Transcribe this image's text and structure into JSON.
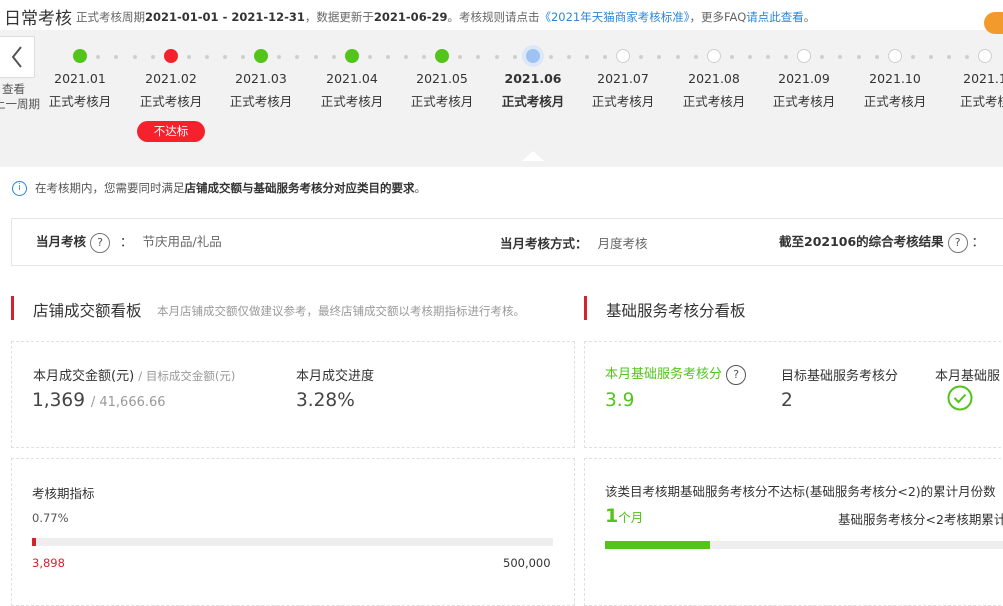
{
  "header": {
    "title": "日常考核",
    "period_prefix": "正式考核周期",
    "period_range": "2021-01-01 - 2021-12-31",
    "update_prefix": "，数据更新于",
    "update_date": "2021-06-29",
    "rules_text": "。考核规则请点击",
    "rules_link": "《2021年天猫商家考核标准》",
    "faq_text": "，更多FAQ",
    "faq_link": "请点此查看",
    "period_end": "。"
  },
  "timeline": {
    "back_label_1": "查看",
    "back_label_2": "上一周期",
    "months": [
      {
        "label": "2021.01",
        "sub": "正式考核月",
        "status": "pass"
      },
      {
        "label": "2021.02",
        "sub": "正式考核月",
        "status": "fail"
      },
      {
        "label": "2021.03",
        "sub": "正式考核月",
        "status": "pass"
      },
      {
        "label": "2021.04",
        "sub": "正式考核月",
        "status": "pass"
      },
      {
        "label": "2021.05",
        "sub": "正式考核月",
        "status": "pass"
      },
      {
        "label": "2021.06",
        "sub": "正式考核月",
        "status": "current"
      },
      {
        "label": "2021.07",
        "sub": "正式考核月",
        "status": "future"
      },
      {
        "label": "2021.08",
        "sub": "正式考核月",
        "status": "future"
      },
      {
        "label": "2021.09",
        "sub": "正式考核月",
        "status": "future"
      },
      {
        "label": "2021.10",
        "sub": "正式考核月",
        "status": "future"
      },
      {
        "label": "2021.1",
        "sub": "正式考核",
        "status": "future"
      }
    ],
    "fail_badge": "不达标",
    "colors": {
      "pass": "#52c41a",
      "fail": "#f5222d",
      "current": "#9ec3f3"
    }
  },
  "info": {
    "text_1": "在考核期内，您需要同时满足",
    "text_bold": "店铺成交额与基础服务考核分对应类目的要求",
    "text_2": "。"
  },
  "summary": {
    "month_label": "当月考核",
    "colon": "：",
    "month_value": "节庆用品/礼品",
    "method_label": "当月考核方式：",
    "method_value": "月度考核",
    "result_label": "截至202106的综合考核结果",
    "result_colon": "："
  },
  "left_section": {
    "title": "店铺成交额看板",
    "subtitle": "本月店铺成交额仅做建议参考，最终店铺成交额以考核期指标进行考核。",
    "card1": {
      "amount_label": "本月成交金额(元)",
      "target_label": "/ 目标成交金额(元)",
      "amount_value": "1,369",
      "target_value": "/ 41,666.66",
      "progress_label": "本月成交进度",
      "progress_value": "3.28%"
    },
    "card2": {
      "label": "考核期指标",
      "percent": "0.77%",
      "current": "3,898",
      "max": "500,000",
      "progress": 0.0077
    }
  },
  "right_section": {
    "title": "基础服务考核分看板",
    "card1": {
      "score_label": "本月基础服务考核分",
      "score_value": "3.9",
      "target_label": "目标基础服务考核分",
      "target_value": "2",
      "status_label": "本月基础服"
    },
    "card2": {
      "text": "该类目考核期基础服务考核分不达标(基础服务考核分<2)的累计月份数",
      "count": "1",
      "count_unit": "个月",
      "rule_text": "基础服务考核分<2考核期累计",
      "progress": 0.25
    }
  }
}
